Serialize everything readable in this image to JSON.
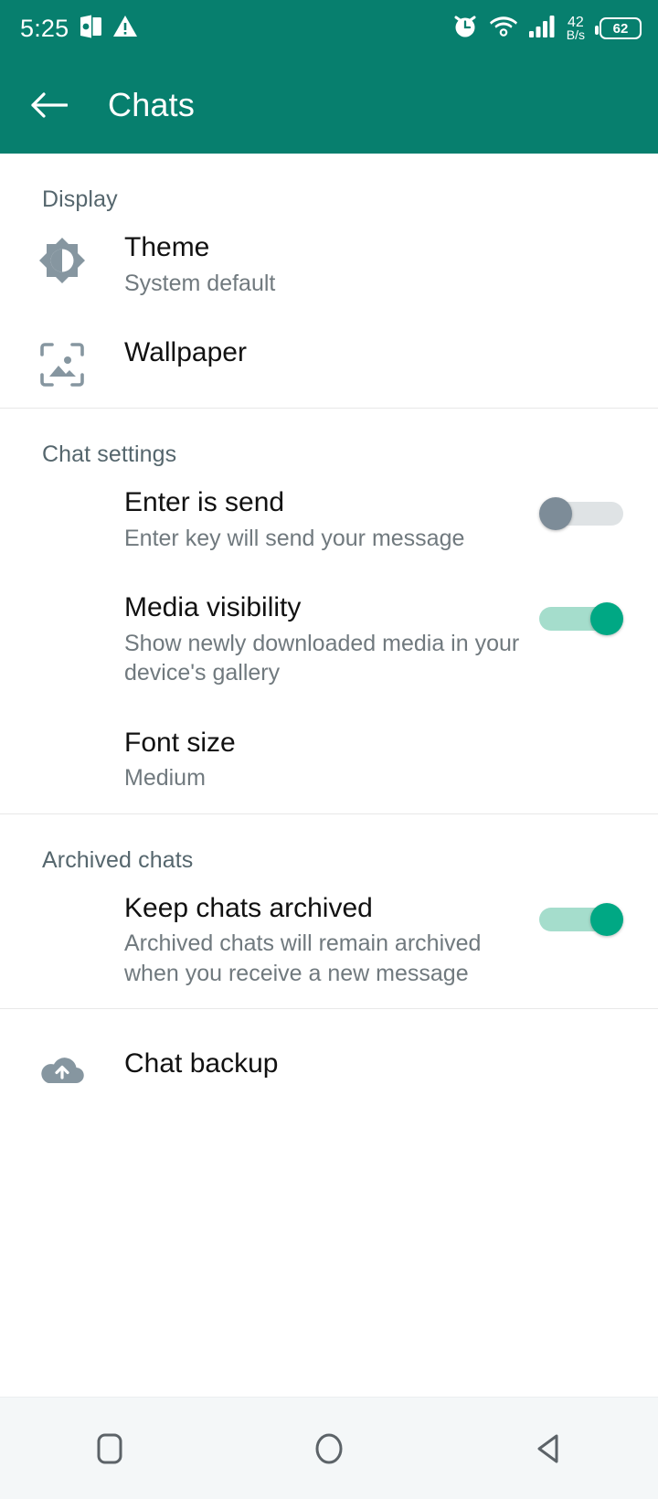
{
  "status_bar": {
    "time": "5:25",
    "icons_left": [
      "powerpoint-icon",
      "warning-triangle-icon"
    ],
    "icons_right": [
      "alarm-icon",
      "wifi-icon",
      "signal-icon"
    ],
    "network_speed_value": "42",
    "network_speed_unit": "B/s",
    "battery_percent": "62",
    "background_color": "#077F6E"
  },
  "app_bar": {
    "back_label": "back-arrow",
    "title": "Chats",
    "background_color": "#077F6E",
    "text_color": "#ffffff"
  },
  "sections": [
    {
      "header": "Display",
      "rows": [
        {
          "icon": "brightness-icon",
          "title": "Theme",
          "subtitle": "System default",
          "toggle": null
        },
        {
          "icon": "wallpaper-icon",
          "title": "Wallpaper",
          "subtitle": "",
          "toggle": null
        }
      ]
    },
    {
      "header": "Chat settings",
      "rows": [
        {
          "icon": "",
          "title": "Enter is send",
          "subtitle": "Enter key will send your message",
          "toggle": "off"
        },
        {
          "icon": "",
          "title": "Media visibility",
          "subtitle": "Show newly downloaded media in your device's gallery",
          "toggle": "on"
        },
        {
          "icon": "",
          "title": "Font size",
          "subtitle": "Medium",
          "toggle": null
        }
      ]
    },
    {
      "header": "Archived chats",
      "rows": [
        {
          "icon": "",
          "title": "Keep chats archived",
          "subtitle": "Archived chats will remain archived when you receive a new message",
          "toggle": "on"
        }
      ]
    },
    {
      "header": "",
      "rows": [
        {
          "icon": "cloud-upload-icon",
          "title": "Chat backup",
          "subtitle": "",
          "toggle": null
        }
      ]
    }
  ],
  "colors": {
    "accent_green": "#00a884",
    "toggle_on_track": "#a5ddcc",
    "toggle_off_thumb": "#7d8c98",
    "icon_gray": "#8696a0",
    "title_text": "#111111",
    "subtitle_text": "#70797e",
    "section_header_text": "#55666d"
  },
  "nav_bar": {
    "buttons": [
      "recents-square-icon",
      "home-circle-icon",
      "back-triangle-icon"
    ],
    "background_color": "#f4f7f8"
  }
}
